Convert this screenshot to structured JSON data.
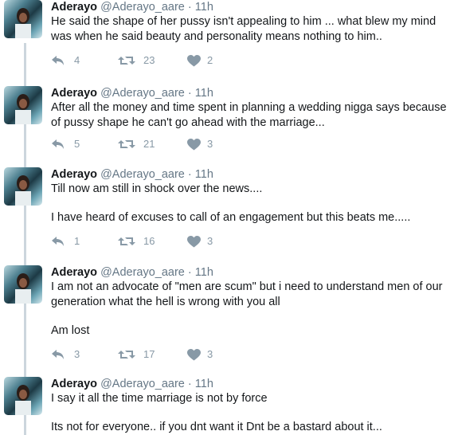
{
  "tweets": [
    {
      "name": "Aderayo",
      "handle": "@Aderayo_aare",
      "dot": "·",
      "time": "11h",
      "paragraphs": [
        "He said the shape of her pussy isn't appealing to him ... what blew my mind was when he said beauty and personality means nothing to him.."
      ],
      "replies": "4",
      "retweets": "23",
      "likes": "2"
    },
    {
      "name": "Aderayo",
      "handle": "@Aderayo_aare",
      "dot": "·",
      "time": "11h",
      "paragraphs": [
        "After all the money and time spent in planning a wedding nigga says because of pussy shape he can't go ahead with the marriage..."
      ],
      "replies": "5",
      "retweets": "21",
      "likes": "3"
    },
    {
      "name": "Aderayo",
      "handle": "@Aderayo_aare",
      "dot": "·",
      "time": "11h",
      "paragraphs": [
        "Till now am still in shock over the news....",
        "I have heard of excuses to call of an engagement but this beats me....."
      ],
      "replies": "1",
      "retweets": "16",
      "likes": "3"
    },
    {
      "name": "Aderayo",
      "handle": "@Aderayo_aare",
      "dot": "·",
      "time": "11h",
      "paragraphs": [
        "I am not an advocate of \"men are scum\" but i need to understand men of our generation what the hell  is wrong with you all",
        "Am lost"
      ],
      "replies": "3",
      "retweets": "17",
      "likes": "3"
    },
    {
      "name": "Aderayo",
      "handle": "@Aderayo_aare",
      "dot": "·",
      "time": "11h",
      "paragraphs": [
        "I say it all the time marriage is not by force",
        "Its not for everyone.. if you dnt want it Dnt be a bastard about it..."
      ]
    }
  ],
  "icons": {
    "reply": "reply-icon",
    "retweet": "retweet-icon",
    "like": "heart-icon"
  },
  "colors": {
    "thread_line": "#ccd6dd",
    "action_gray": "#8899a6",
    "meta_gray": "#657786"
  }
}
